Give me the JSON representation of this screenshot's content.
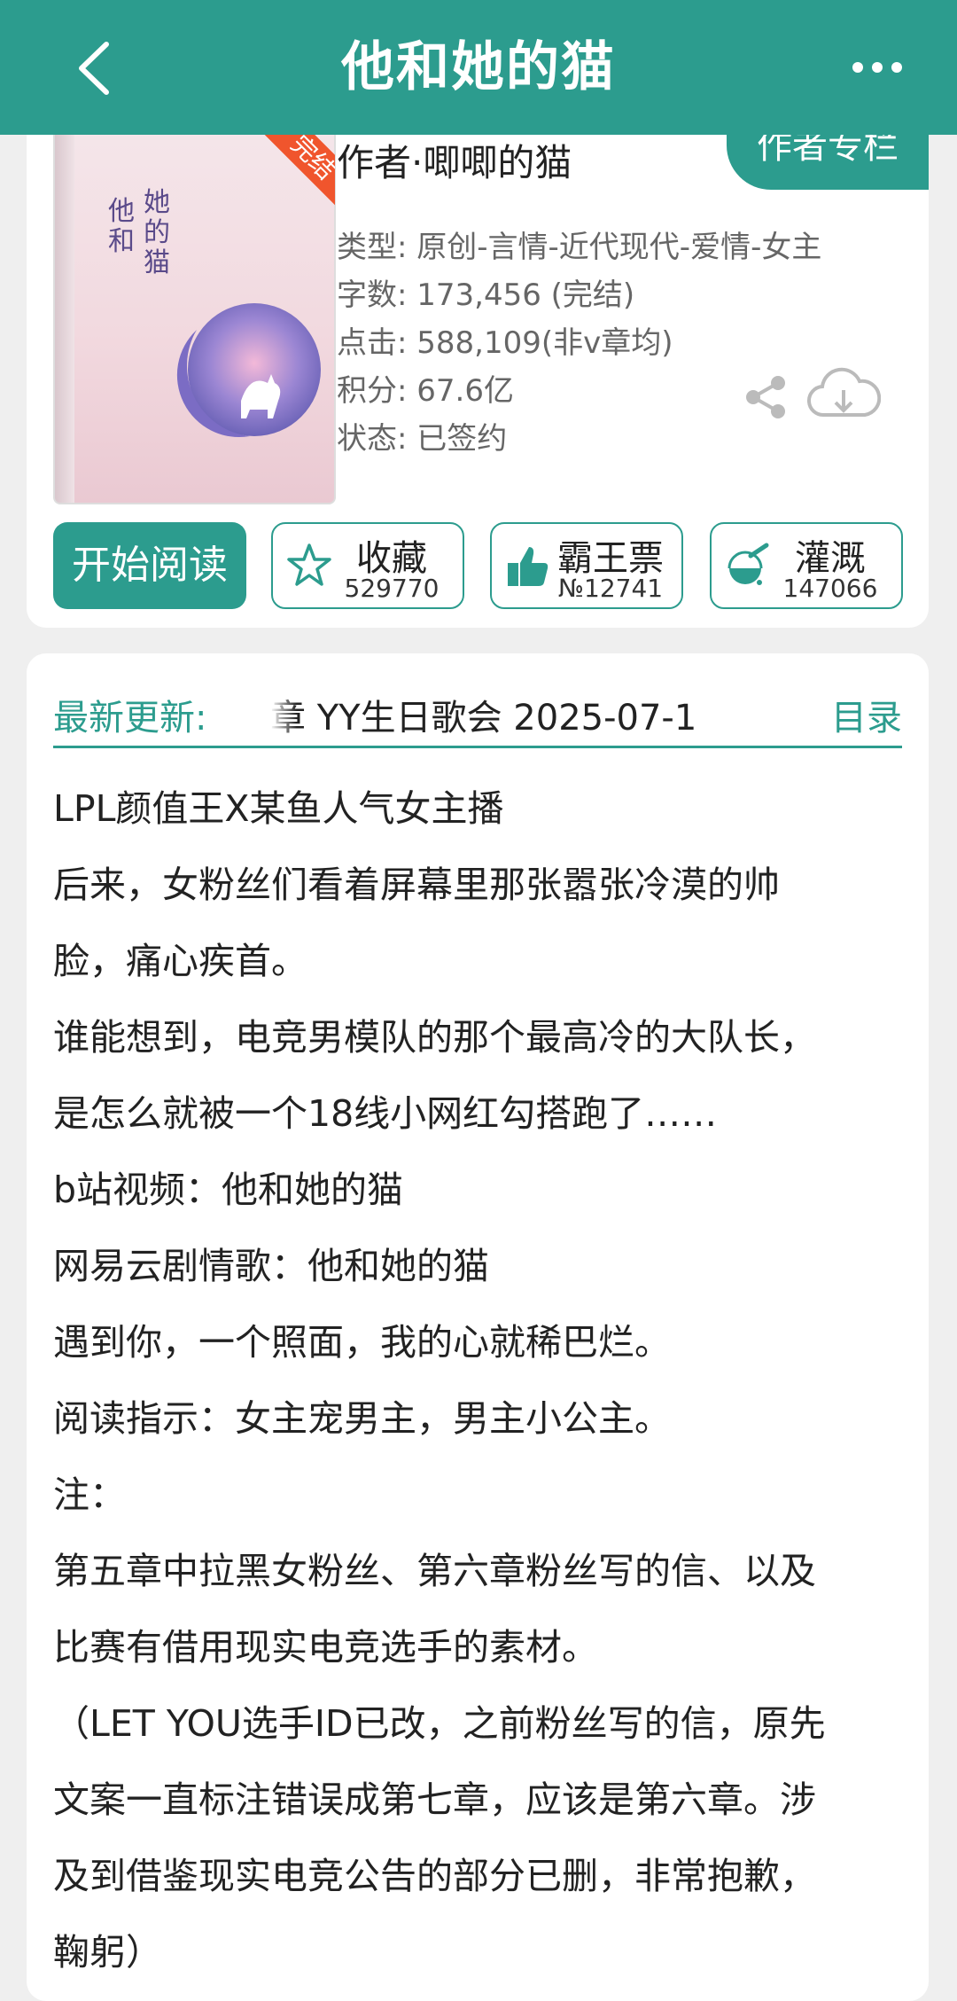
{
  "header": {
    "title": "他和她的猫",
    "back_icon": "back-arrow-icon",
    "more_icon": "more-dots-icon",
    "bg_color": "#2c9c8e"
  },
  "book": {
    "ribbon": "完结",
    "cover_title_1": "他和",
    "cover_title_2": "她的猫",
    "author_column_label": "作者专栏",
    "author": "作者·唧唧的猫",
    "info": [
      "类型: 原创-言情-近代现代-爱情-女主",
      "字数: 173,456 (完结)",
      "点击: 588,109(非v章均)",
      "积分: 67.6亿",
      "状态: 已签约"
    ]
  },
  "actions": {
    "read_label": "开始阅读",
    "favorite": {
      "label": "收藏",
      "count": "529770",
      "icon": "star-icon"
    },
    "vote": {
      "label": "霸王票",
      "count": "№12741",
      "icon": "thumbs-up-icon"
    },
    "water": {
      "label": "灌溉",
      "count": "147066",
      "icon": "watering-flask-icon"
    }
  },
  "latest": {
    "label": "最新更新:",
    "text": "章  YY生日歌会  2025-07-1",
    "toc_label": "目录"
  },
  "description": [
    "LPL颜值王X某鱼人气女主播",
    "后来，女粉丝们看着屏幕里那张嚣张冷漠的帅",
    "脸，痛心疾首。",
    "谁能想到，电竞男模队的那个最高冷的大队长，",
    "是怎么就被一个18线小网红勾搭跑了……",
    "b站视频：他和她的猫",
    "网易云剧情歌：他和她的猫",
    "遇到你，一个照面，我的心就稀巴烂。",
    "阅读指示：女主宠男主，男主小公主。",
    "注：",
    "第五章中拉黑女粉丝、第六章粉丝写的信、以及",
    "比赛有借用现实电竞选手的素材。",
    "（LET YOU选手ID已改，之前粉丝写的信，原先",
    "文案一直标注错误成第七章，应该是第六章。涉",
    "及到借鉴现实电竞公告的部分已删，非常抱歉，",
    "鞠躬）"
  ]
}
